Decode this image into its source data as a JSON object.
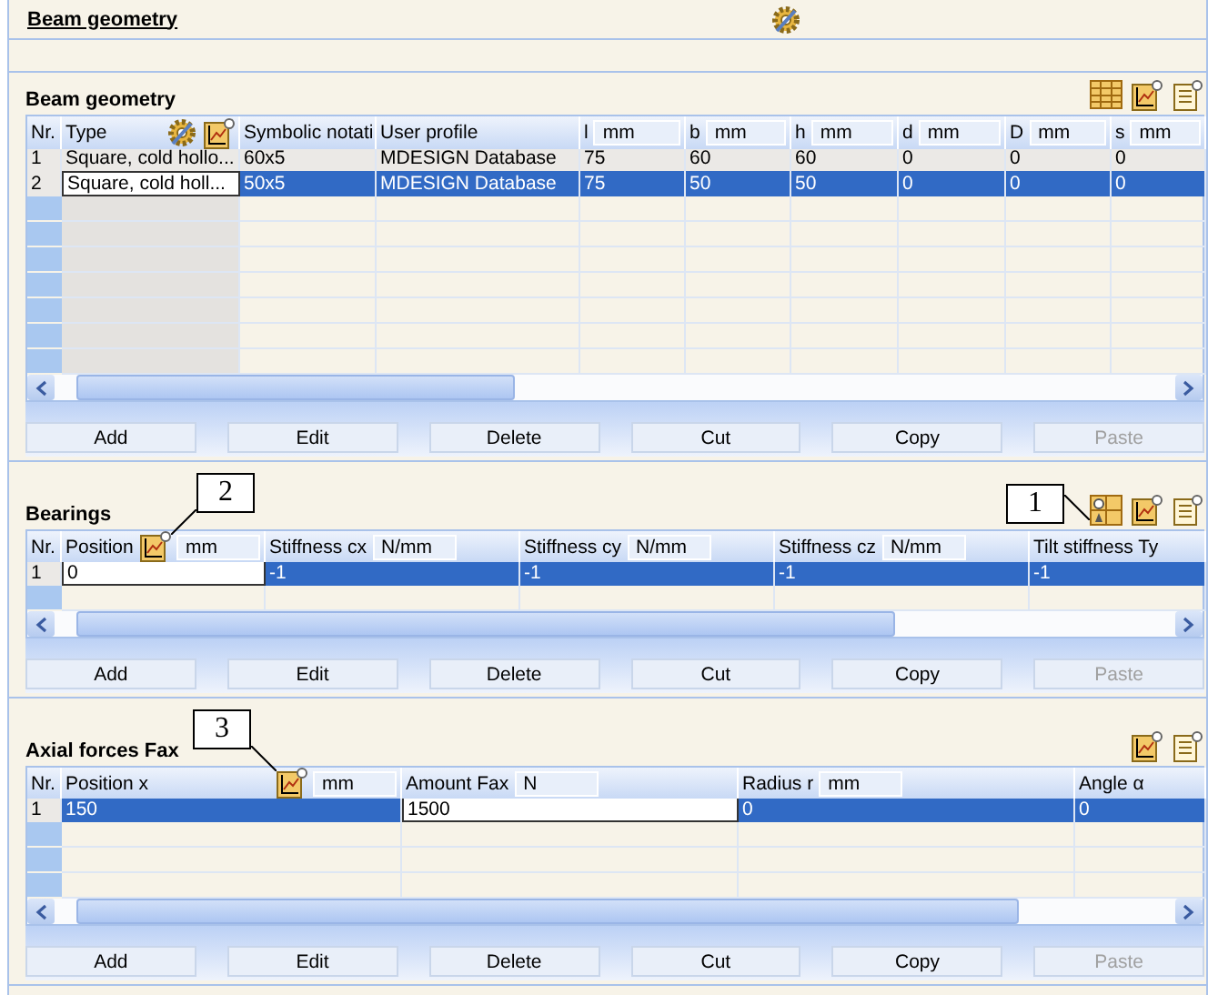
{
  "header": {
    "title": "Beam geometry"
  },
  "sections": [
    {
      "title": "Beam geometry",
      "toolbar": [
        {
          "kind": "grid"
        },
        {
          "kind": "chart"
        },
        {
          "kind": "notes"
        }
      ],
      "columns": [
        {
          "label": "Nr."
        },
        {
          "label": "Type",
          "icons": [
            {
              "kind": "gear"
            },
            {
              "kind": "chart"
            }
          ],
          "shaded": true
        },
        {
          "label": "Symbolic notati"
        },
        {
          "label": "User profile"
        },
        {
          "label": "l",
          "unit": "mm"
        },
        {
          "label": "b",
          "unit": "mm"
        },
        {
          "label": "h",
          "unit": "mm"
        },
        {
          "label": "d",
          "unit": "mm"
        },
        {
          "label": "D",
          "unit": "mm"
        },
        {
          "label": "s",
          "unit": "mm"
        }
      ],
      "rows": [
        {
          "selected": false,
          "cells": [
            {
              "text": "1",
              "editing": false
            },
            {
              "text": "Square, cold hollo...",
              "editing": false
            },
            {
              "text": "60x5",
              "editing": false
            },
            {
              "text": "MDESIGN Database",
              "editing": false
            },
            {
              "text": "75",
              "editing": false
            },
            {
              "text": "60",
              "editing": false
            },
            {
              "text": "60",
              "editing": false
            },
            {
              "text": "0",
              "editing": false
            },
            {
              "text": "0",
              "editing": false
            },
            {
              "text": "0",
              "editing": false
            }
          ]
        },
        {
          "selected": true,
          "cells": [
            {
              "text": "2",
              "editing": false
            },
            {
              "text": "Square, cold holl...",
              "editing": true
            },
            {
              "text": "50x5",
              "editing": false
            },
            {
              "text": "MDESIGN Database",
              "editing": false
            },
            {
              "text": "75",
              "editing": false
            },
            {
              "text": "50",
              "editing": false
            },
            {
              "text": "50",
              "editing": false
            },
            {
              "text": "0",
              "editing": false
            },
            {
              "text": "0",
              "editing": false
            },
            {
              "text": "0",
              "editing": false
            }
          ]
        }
      ],
      "buttons": [
        {
          "label": "Add",
          "disabled": false
        },
        {
          "label": "Edit",
          "disabled": false
        },
        {
          "label": "Delete",
          "disabled": false
        },
        {
          "label": "Cut",
          "disabled": false
        },
        {
          "label": "Copy",
          "disabled": false
        },
        {
          "label": "Paste",
          "disabled": true
        }
      ]
    },
    {
      "title": "Bearings",
      "toolbar": [
        {
          "kind": "bearing",
          "callout": "1"
        },
        {
          "kind": "chart"
        },
        {
          "kind": "notes"
        }
      ],
      "columns": [
        {
          "label": "Nr."
        },
        {
          "label": "Position",
          "unit": "mm",
          "icons": [
            {
              "kind": "chart",
              "callout": "2"
            }
          ]
        },
        {
          "label": "Stiffness cx",
          "unit": "N/mm"
        },
        {
          "label": "Stiffness cy",
          "unit": "N/mm"
        },
        {
          "label": "Stiffness cz",
          "unit": "N/mm"
        },
        {
          "label": "Tilt stiffness Ty"
        }
      ],
      "rows": [
        {
          "selected": true,
          "cells": [
            {
              "text": "1",
              "editing": false
            },
            {
              "text": "0",
              "editing": true
            },
            {
              "text": "-1",
              "editing": false
            },
            {
              "text": "-1",
              "editing": false
            },
            {
              "text": "-1",
              "editing": false
            },
            {
              "text": "-1",
              "editing": false
            }
          ]
        }
      ],
      "buttons": [
        {
          "label": "Add",
          "disabled": false
        },
        {
          "label": "Edit",
          "disabled": false
        },
        {
          "label": "Delete",
          "disabled": false
        },
        {
          "label": "Cut",
          "disabled": false
        },
        {
          "label": "Copy",
          "disabled": false
        },
        {
          "label": "Paste",
          "disabled": true
        }
      ]
    },
    {
      "title": "Axial forces Fax",
      "toolbar": [
        {
          "kind": "chart"
        },
        {
          "kind": "notes"
        }
      ],
      "columns": [
        {
          "label": "Nr."
        },
        {
          "label": "Position x",
          "unit": "mm",
          "icons": [
            {
              "kind": "chart",
              "callout": "3"
            }
          ]
        },
        {
          "label": "Amount Fax",
          "unit": "N"
        },
        {
          "label": "Radius r",
          "unit": "mm"
        },
        {
          "label": "Angle α"
        }
      ],
      "rows": [
        {
          "selected": true,
          "cells": [
            {
              "text": "1",
              "editing": false
            },
            {
              "text": "150",
              "editing": false
            },
            {
              "text": "1500",
              "editing": true
            },
            {
              "text": "0",
              "editing": false
            },
            {
              "text": "0",
              "editing": false
            }
          ]
        }
      ],
      "buttons": [
        {
          "label": "Add",
          "disabled": false
        },
        {
          "label": "Edit",
          "disabled": false
        },
        {
          "label": "Delete",
          "disabled": false
        },
        {
          "label": "Cut",
          "disabled": false
        },
        {
          "label": "Copy",
          "disabled": false
        },
        {
          "label": "Paste",
          "disabled": true
        }
      ]
    }
  ]
}
